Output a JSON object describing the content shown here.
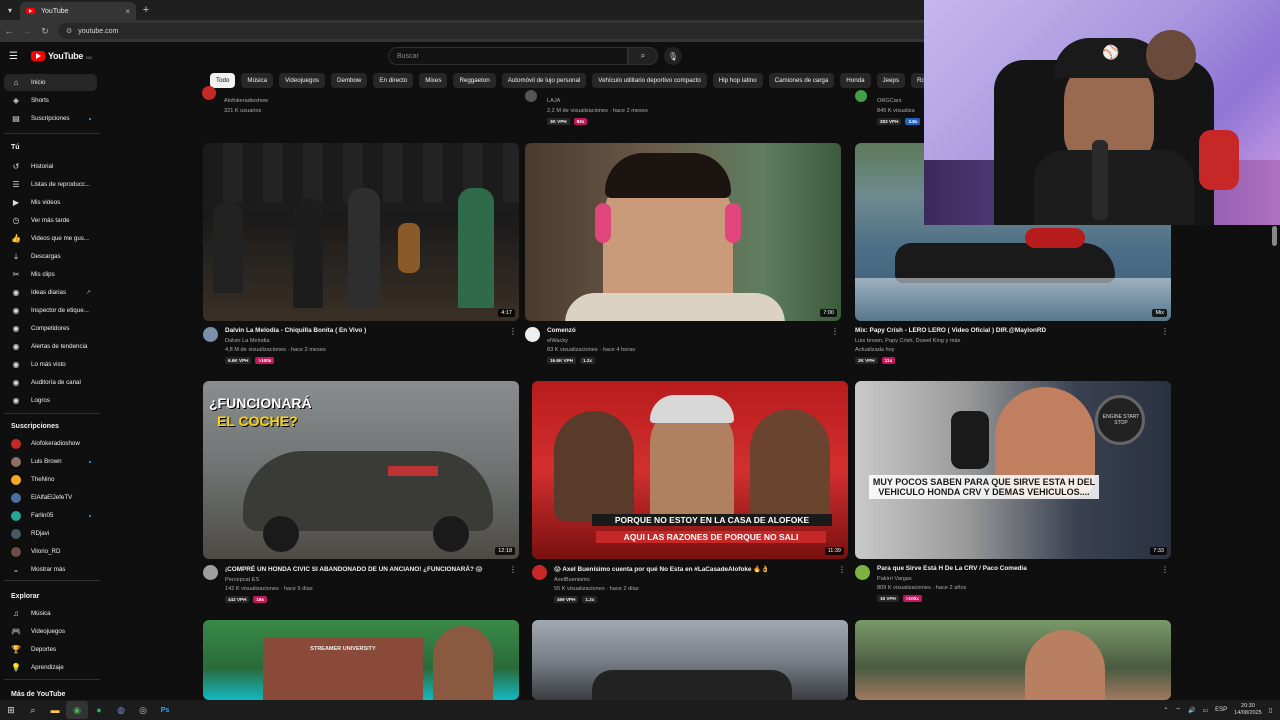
{
  "browser": {
    "tab_title": "YouTube",
    "tab_close": "×",
    "new_tab": "+",
    "url": "youtube.com"
  },
  "masthead": {
    "logo_text": "YouTube",
    "logo_suffix": "DO",
    "search_placeholder": "Buscar"
  },
  "chips": [
    "Todo",
    "Música",
    "Videojuegos",
    "Dembow",
    "En directo",
    "Mixes",
    "Reggaeton",
    "Automóvil de lujo personal",
    "Vehículo utilitario deportivo compacto",
    "Hip hop latino",
    "Camiones de carga",
    "Honda",
    "Jeeps",
    "Rocks"
  ],
  "sidebar": {
    "main": [
      {
        "label": "Inicio",
        "icon": "home-icon",
        "glyph": "⌂"
      },
      {
        "label": "Shorts",
        "icon": "shorts-icon",
        "glyph": "◈"
      },
      {
        "label": "Suscripciones",
        "icon": "subscriptions-icon",
        "glyph": "▤"
      }
    ],
    "you_heading": "Tú",
    "you": [
      {
        "label": "Historial",
        "icon": "history-icon",
        "glyph": "↺"
      },
      {
        "label": "Listas de reproducc...",
        "icon": "playlists-icon",
        "glyph": "☰"
      },
      {
        "label": "Mis videos",
        "icon": "my-videos-icon",
        "glyph": "▶"
      },
      {
        "label": "Ver más tarde",
        "icon": "watch-later-icon",
        "glyph": "◷"
      },
      {
        "label": "Videos que me gus...",
        "icon": "thumb-up-icon",
        "glyph": "👍"
      },
      {
        "label": "Descargas",
        "icon": "download-icon",
        "glyph": "⤓"
      },
      {
        "label": "Mis clips",
        "icon": "scissors-icon",
        "glyph": "✂"
      },
      {
        "label": "Ideas diarias",
        "icon": "ideas-icon",
        "glyph": "◉"
      },
      {
        "label": "Inspector de etique...",
        "icon": "tag-inspector-icon",
        "glyph": "◉"
      },
      {
        "label": "Competidores",
        "icon": "competitors-icon",
        "glyph": "◉"
      },
      {
        "label": "Alertas de tendencia",
        "icon": "trend-alerts-icon",
        "glyph": "◉"
      },
      {
        "label": "Lo más visto",
        "icon": "most-viewed-icon",
        "glyph": "◉"
      },
      {
        "label": "Auditoría de canal",
        "icon": "channel-audit-icon",
        "glyph": "◉"
      },
      {
        "label": "Logros",
        "icon": "achievements-icon",
        "glyph": "◉"
      }
    ],
    "subs_heading": "Suscripciones",
    "subs": [
      {
        "label": "Alofokeradioshow",
        "color": "#c62828",
        "dot": false
      },
      {
        "label": "Luis Brown",
        "color": "#8d6e63",
        "dot": true
      },
      {
        "label": "TheNino",
        "color": "#f9a825",
        "dot": false
      },
      {
        "label": "ElAlfaElJefeTV",
        "color": "#4a6fa5",
        "dot": false
      },
      {
        "label": "Farlin05",
        "color": "#26a69a",
        "dot": true
      },
      {
        "label": "RDjavi",
        "color": "#455a64",
        "dot": false
      },
      {
        "label": "Vilorio_RD",
        "color": "#6d4c41",
        "dot": false
      }
    ],
    "show_more": "Mostrar más",
    "explore_heading": "Explorar",
    "explore": [
      {
        "label": "Música",
        "icon": "music-icon",
        "glyph": "♫"
      },
      {
        "label": "Videojuegos",
        "icon": "gaming-icon",
        "glyph": "🎮"
      },
      {
        "label": "Deportes",
        "icon": "sports-icon",
        "glyph": "🏆"
      },
      {
        "label": "Aprendizaje",
        "icon": "learning-icon",
        "glyph": "💡"
      }
    ],
    "more_heading": "Más de YouTube"
  },
  "top_partial": [
    {
      "channel": "Alofokeradioshow",
      "stats": "321 K usuarios"
    },
    {
      "channel": "LAJA",
      "stats": "2,2 M de visualizaciones · hace 2 meses",
      "badges": [
        "3K VPH",
        "93x"
      ]
    },
    {
      "channel": "ORGCars",
      "stats": "845 K visualiza",
      "badges": [
        "283 VPH",
        "3.8x"
      ]
    }
  ],
  "videos": [
    {
      "title": "Dalvin La Melodia - Chiquilla Bonita ( En Vivo )",
      "channel": "Dalvin La Melodia",
      "stats": "4,8 M de visualizaciones · hace 2 meses",
      "duration": "4:17",
      "badges": [
        "6.6K VPH",
        ">100x"
      ]
    },
    {
      "title": "Comenzó",
      "channel": "elWacky",
      "stats": "83 K visualizaciones · hace 4 horas",
      "duration": "7:00",
      "badges": [
        "16.6K VPH",
        "1.2x"
      ]
    },
    {
      "title": "Mix: Papy Crish - LERO LERO ( Video Oficial ) DIR.@MaylonRD",
      "channel": "Luis brown, Papy Crish, Dowel King y más",
      "stats": "Actualizada hoy",
      "duration": "Mix",
      "badges": [
        "2K VPH",
        "11x"
      ]
    },
    {
      "title": "¡COMPRÉ UN HONDA CIVIC SI ABANDONADO DE UN ANCIANO! ¿FUNCIONARÁ? 😱",
      "channel": "Percepcat ES",
      "stats": "142 K visualizaciones · hace 5 días",
      "duration": "12:18",
      "badges": [
        "442 VPH",
        "16x"
      ],
      "caption1": "¿FUNCIONARÁ",
      "caption2": "EL COCHE?"
    },
    {
      "title": "😱 Axel Buenísimo cuenta por qué No Esta en #LaCasadeAlofoke 🔥👌",
      "channel": "AxelBuenismo",
      "stats": "55 K visualizaciones · hace 2 días",
      "duration": "11:39",
      "badges": [
        "459 VPH",
        "1.2x"
      ],
      "caption1": "PORQUE NO ESTOY EN LA CASA DE ALOFOKE",
      "caption2": "AQUI LAS RAZONES DE PORQUE NO SALI"
    },
    {
      "title": "Para que Sirve Está H De La CRV / Paco Comedia",
      "channel": "Pakirri Vargas",
      "stats": "809 K visualizaciones · hace 2 años",
      "duration": "7:33",
      "badges": [
        "16 VPH",
        ">100x"
      ],
      "caption1": "MUY POCOS SABEN PARA QUE SIRVE ESTA H DEL VEHICULO HONDA CRV Y DEMAS VEHICULOS....",
      "caption2": "ENGINE START STOP"
    }
  ],
  "bottom_caption": "STREAMER UNIVERSITY",
  "taskbar": {
    "language": "ESP",
    "time": "20:30",
    "date": "14/08/2025"
  }
}
